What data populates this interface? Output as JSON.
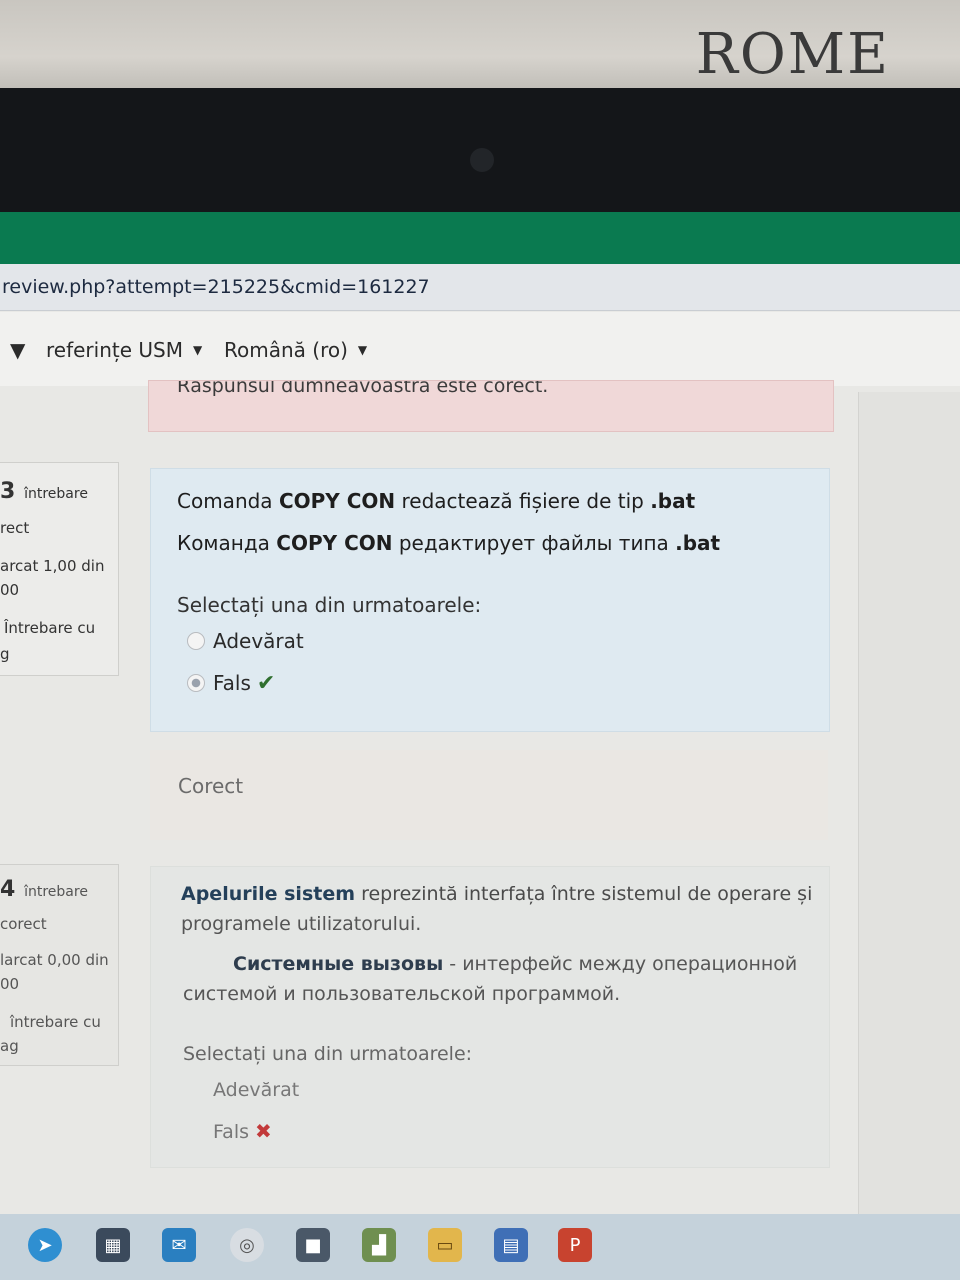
{
  "wall": {
    "sign_text": "ROME"
  },
  "browser": {
    "url": "review.php?attempt=215225&cmid=161227"
  },
  "navbar": {
    "items": [
      {
        "label": "referințe USM"
      },
      {
        "label": "Română (ro)"
      }
    ]
  },
  "previous_feedback": {
    "text": "Răspunsul dumneavoastră este corect."
  },
  "question3": {
    "info": {
      "number": "3",
      "number_label": "întrebare",
      "status": "rect",
      "mark": "arcat 1,00 din",
      "mark_max": "00",
      "flag": "Întrebare cu",
      "flag2": "g"
    },
    "text_ro_pre": "Comanda ",
    "text_ro_bold": "COPY CON",
    "text_ro_mid": " redactează fișiere de tip ",
    "text_ro_ext": ".bat",
    "text_ru_pre": "Команда ",
    "text_ru_bold": "COPY CON",
    "text_ru_mid": " редактирует файлы типа ",
    "text_ru_ext": ".bat",
    "prompt": "Selectați una din urmatoarele:",
    "options": [
      {
        "label": "Adevărat",
        "selected": false
      },
      {
        "label": "Fals",
        "selected": true,
        "mark": "correct"
      }
    ],
    "outcome": "Corect"
  },
  "question4": {
    "info": {
      "number": "4",
      "number_label": "întrebare",
      "status": "corect",
      "mark": "larcat 0,00 din",
      "mark_max": "00",
      "flag": "întrebare cu",
      "flag2": "ag"
    },
    "text_ro_bold": "Apelurile sistem",
    "text_ro_rest": " reprezintă interfața între sistemul de operare și",
    "text_ro_line2": "programele utilizatorului.",
    "text_ru_bold": "Системные вызовы",
    "text_ru_rest": " - интерфейс между операционной",
    "text_ru_line2": "системой и пользовательской программой.",
    "prompt": "Selectați una din urmatoarele:",
    "options": [
      {
        "label": "Adevărat"
      },
      {
        "label": "Fals",
        "mark": "incorrect"
      }
    ]
  },
  "taskbar": {
    "icons": [
      {
        "name": "telegram-icon",
        "color": "#2f8fd1"
      },
      {
        "name": "store-icon",
        "color": "#3b4a5c"
      },
      {
        "name": "mail-icon",
        "color": "#2a7fc0"
      },
      {
        "name": "chrome-icon",
        "color": "#d8dde2"
      },
      {
        "name": "box-icon",
        "color": "#4a5868"
      },
      {
        "name": "chart-icon",
        "color": "#6f8f50"
      },
      {
        "name": "folder-icon",
        "color": "#e2b64c"
      },
      {
        "name": "word-icon",
        "color": "#3f6fb6"
      },
      {
        "name": "powerpoint-icon",
        "color": "#c8432f"
      }
    ]
  }
}
